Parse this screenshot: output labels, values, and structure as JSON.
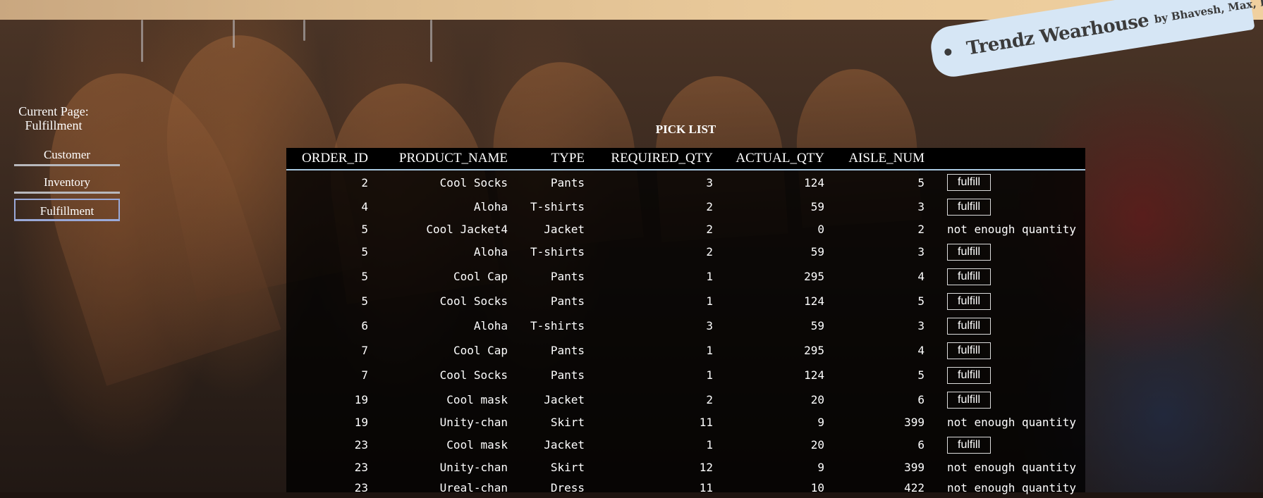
{
  "brand": {
    "title": "Trendz Wearhouse",
    "byline": "by Bhavesh, Max, Erin"
  },
  "sidebar": {
    "current_page_label": "Current Page:",
    "current_page_value": "Fulfillment",
    "items": [
      {
        "label": "Customer",
        "active": false
      },
      {
        "label": "Inventory",
        "active": false
      },
      {
        "label": "Fulfillment",
        "active": true
      }
    ]
  },
  "pick_list": {
    "title": "PICK LIST",
    "columns": [
      "ORDER_ID",
      "PRODUCT_NAME",
      "TYPE",
      "REQUIRED_QTY",
      "ACTUAL_QTY",
      "AISLE_NUM"
    ],
    "fulfill_label": "fulfill",
    "not_enough_label": "not enough quantity",
    "rows": [
      {
        "order_id": "2",
        "product_name": "Cool Socks",
        "type": "Pants",
        "required_qty": "3",
        "actual_qty": "124",
        "aisle_num": "5",
        "action": "fulfill"
      },
      {
        "order_id": "4",
        "product_name": "Aloha",
        "type": "T-shirts",
        "required_qty": "2",
        "actual_qty": "59",
        "aisle_num": "3",
        "action": "fulfill"
      },
      {
        "order_id": "5",
        "product_name": "Cool Jacket4",
        "type": "Jacket",
        "required_qty": "2",
        "actual_qty": "0",
        "aisle_num": "2",
        "action": "not enough quantity"
      },
      {
        "order_id": "5",
        "product_name": "Aloha",
        "type": "T-shirts",
        "required_qty": "2",
        "actual_qty": "59",
        "aisle_num": "3",
        "action": "fulfill"
      },
      {
        "order_id": "5",
        "product_name": "Cool Cap",
        "type": "Pants",
        "required_qty": "1",
        "actual_qty": "295",
        "aisle_num": "4",
        "action": "fulfill"
      },
      {
        "order_id": "5",
        "product_name": "Cool Socks",
        "type": "Pants",
        "required_qty": "1",
        "actual_qty": "124",
        "aisle_num": "5",
        "action": "fulfill"
      },
      {
        "order_id": "6",
        "product_name": "Aloha",
        "type": "T-shirts",
        "required_qty": "3",
        "actual_qty": "59",
        "aisle_num": "3",
        "action": "fulfill"
      },
      {
        "order_id": "7",
        "product_name": "Cool Cap",
        "type": "Pants",
        "required_qty": "1",
        "actual_qty": "295",
        "aisle_num": "4",
        "action": "fulfill"
      },
      {
        "order_id": "7",
        "product_name": "Cool Socks",
        "type": "Pants",
        "required_qty": "1",
        "actual_qty": "124",
        "aisle_num": "5",
        "action": "fulfill"
      },
      {
        "order_id": "19",
        "product_name": "Cool mask",
        "type": "Jacket",
        "required_qty": "2",
        "actual_qty": "20",
        "aisle_num": "6",
        "action": "fulfill"
      },
      {
        "order_id": "19",
        "product_name": "Unity-chan",
        "type": "Skirt",
        "required_qty": "11",
        "actual_qty": "9",
        "aisle_num": "399",
        "action": "not enough quantity"
      },
      {
        "order_id": "23",
        "product_name": "Cool mask",
        "type": "Jacket",
        "required_qty": "1",
        "actual_qty": "20",
        "aisle_num": "6",
        "action": "fulfill"
      },
      {
        "order_id": "23",
        "product_name": "Unity-chan",
        "type": "Skirt",
        "required_qty": "12",
        "actual_qty": "9",
        "aisle_num": "399",
        "action": "not enough quantity"
      },
      {
        "order_id": "23",
        "product_name": "Ureal-chan",
        "type": "Dress",
        "required_qty": "11",
        "actual_qty": "10",
        "aisle_num": "422",
        "action": "not enough quantity"
      }
    ]
  },
  "colors": {
    "logo_bg": "#d6e6f5",
    "header_underline": "#a8c8e0",
    "active_nav_border": "#9aa9d8"
  }
}
